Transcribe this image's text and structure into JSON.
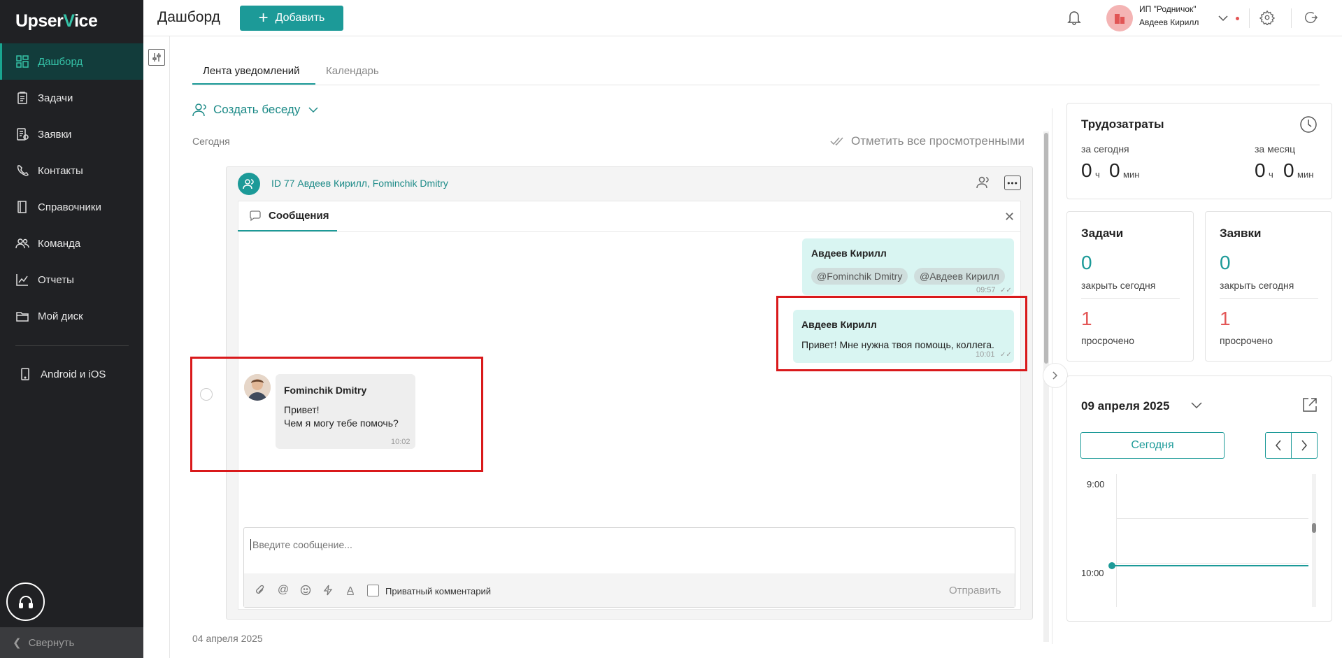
{
  "app": {
    "logo_left": "Upser",
    "logo_v": "V",
    "logo_right": "ice"
  },
  "sidebar": {
    "items": [
      {
        "label": "Дашборд",
        "icon": "dashboard-icon",
        "active": true
      },
      {
        "label": "Задачи",
        "icon": "tasks-icon"
      },
      {
        "label": "Заявки",
        "icon": "requests-icon"
      },
      {
        "label": "Контакты",
        "icon": "contacts-icon"
      },
      {
        "label": "Справочники",
        "icon": "book-icon"
      },
      {
        "label": "Команда",
        "icon": "team-icon"
      },
      {
        "label": "Отчеты",
        "icon": "chart-icon"
      },
      {
        "label": "Мой диск",
        "icon": "folder-icon"
      },
      {
        "label": "Android и iOS",
        "icon": "phone-icon"
      }
    ],
    "collapse_label": "Свернуть"
  },
  "header": {
    "title": "Дашборд",
    "add_label": "Добавить",
    "org_name": "ИП \"Родничок\"",
    "user_name": "Авдеев Кирилл"
  },
  "main": {
    "tabs": [
      {
        "label": "Лента уведомлений",
        "active": true
      },
      {
        "label": "Календарь",
        "active": false
      }
    ],
    "create_conversation": "Создать беседу",
    "today_label": "Сегодня",
    "mark_all_label": "Отметить все просмотренными",
    "conversation": {
      "title": "ID 77 Авдеев Кирилл, Fominchik Dmitry",
      "messages_tab": "Сообщения",
      "messages": [
        {
          "author": "Авдеев Кирилл",
          "mentions": [
            "@Fominchik Dmitry",
            "@Авдеев Кирилл"
          ],
          "time": "09:57",
          "outgoing": true
        },
        {
          "author": "Авдеев Кирилл",
          "text": "Привет! Мне нужна твоя помощь, коллега.",
          "time": "10:01",
          "outgoing": true
        },
        {
          "author": "Fominchik Dmitry",
          "text_line1": "Привет!",
          "text_line2": "Чем я могу тебе помочь?",
          "time": "10:02",
          "outgoing": false
        }
      ],
      "composer_placeholder": "Введите сообщение...",
      "private_label": "Приватный комментарий",
      "send_label": "Отправить"
    },
    "next_date": "04 апреля 2025"
  },
  "widgets": {
    "labor": {
      "title": "Трудозатраты",
      "today_label": "за сегодня",
      "month_label": "за месяц",
      "today_hours": "0",
      "today_minutes": "0",
      "month_hours": "0",
      "month_minutes": "0",
      "unit_h": "ч",
      "unit_m": "мин"
    },
    "tasks": {
      "title": "Задачи",
      "close_today_value": "0",
      "close_today_label": "закрыть сегодня",
      "overdue_value": "1",
      "overdue_label": "просрочено"
    },
    "requests": {
      "title": "Заявки",
      "close_today_value": "0",
      "close_today_label": "закрыть сегодня",
      "overdue_value": "1",
      "overdue_label": "просрочено"
    },
    "calendar": {
      "date": "09 апреля 2025",
      "today_button": "Сегодня",
      "times": [
        "9:00",
        "10:00"
      ]
    }
  },
  "colors": {
    "accent": "#1c9a98",
    "sidebar_bg": "#202124",
    "danger": "#e35757",
    "highlight_box": "#d9191b"
  }
}
